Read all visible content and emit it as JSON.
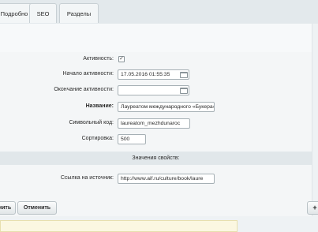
{
  "tabs": [
    {
      "label": "Подробно"
    },
    {
      "label": "SEO"
    },
    {
      "label": "Разделы"
    }
  ],
  "form": {
    "active_label": "Активность:",
    "active_checked": true,
    "start_label": "Начало активности:",
    "start_value": "17.05.2016 01:55:35",
    "end_label": "Окончание активности:",
    "end_value": "",
    "name_label": "Название:",
    "name_value": "Лауреатом международного «Букера» стала автор ром",
    "code_label": "Символьный код:",
    "code_value": "laureatom_mezhdunaroc",
    "sort_label": "Сортировка:",
    "sort_value": "500"
  },
  "properties": {
    "section_title": "Значения свойств:",
    "source_label": "Ссылка на источник:",
    "source_value": "http://www.aif.ru/culture/book/laure"
  },
  "buttons": {
    "save_partial": "нить",
    "cancel": "Отменить",
    "plus": "+"
  }
}
